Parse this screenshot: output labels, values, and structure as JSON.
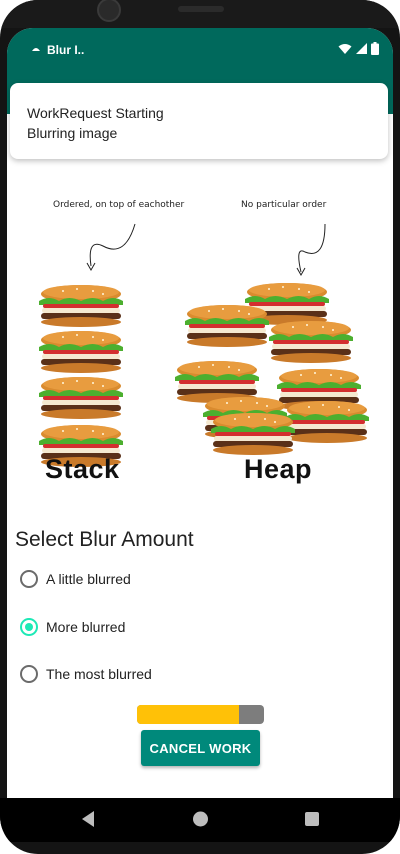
{
  "status_bar": {
    "app_title": "Blur I..",
    "icons": [
      "wifi-icon",
      "signal-icon",
      "battery-icon"
    ]
  },
  "toast": {
    "line1": "WorkRequest Starting",
    "line2": "Blurring image"
  },
  "illustration": {
    "stack_caption": "Ordered, on top of eachother",
    "heap_caption": "No particular order",
    "stack_label": "Stack",
    "heap_label": "Heap"
  },
  "blur_section": {
    "title": "Select Blur Amount",
    "options": [
      {
        "label": "A little blurred",
        "selected": false
      },
      {
        "label": "More blurred",
        "selected": true
      },
      {
        "label": "The most blurred",
        "selected": false
      }
    ]
  },
  "progress": {
    "value": 0.8
  },
  "cancel_button": {
    "label": "CANCEL WORK"
  },
  "colors": {
    "primary": "#00695c",
    "accent": "#1de9b6",
    "button": "#00897b",
    "progress": "#ffc107"
  },
  "navigation": {
    "icons": [
      "back-icon",
      "home-icon",
      "recents-icon"
    ]
  }
}
